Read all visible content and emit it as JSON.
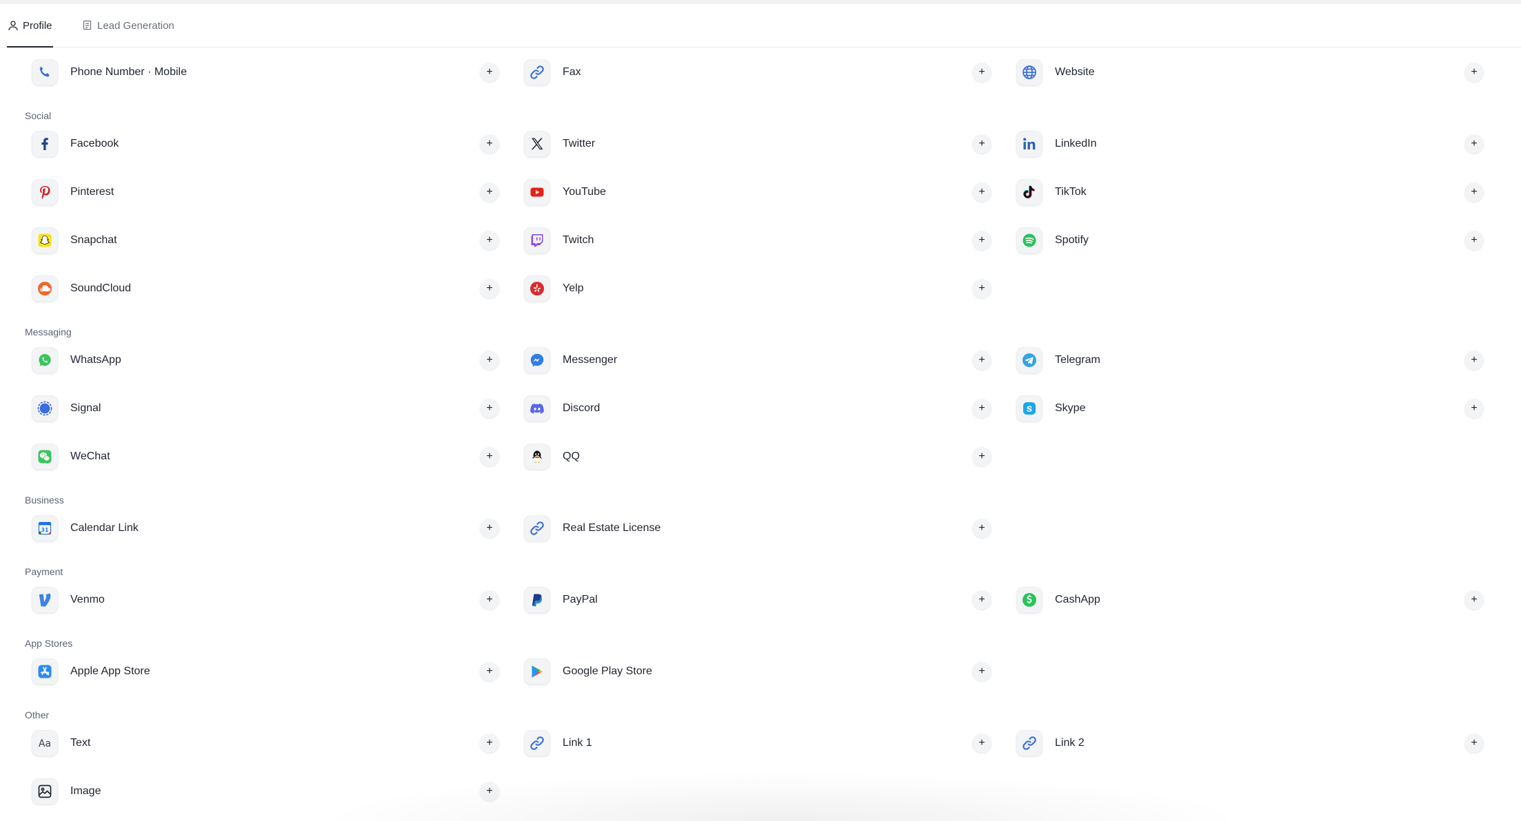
{
  "tabs": [
    {
      "label": "Profile",
      "icon": "user-icon",
      "active": true
    },
    {
      "label": "Lead Generation",
      "icon": "form-icon",
      "active": false
    }
  ],
  "add_label": "+",
  "rows": [
    {
      "type": "items",
      "items": [
        {
          "label": "Phone Number · Mobile",
          "icon": "phone-icon"
        },
        {
          "label": "Fax",
          "icon": "link-icon"
        },
        {
          "label": "Website",
          "icon": "globe-icon"
        }
      ]
    },
    {
      "type": "section",
      "label": "Social"
    },
    {
      "type": "items",
      "items": [
        {
          "label": "Facebook",
          "icon": "facebook-icon"
        },
        {
          "label": "Twitter",
          "icon": "x-twitter-icon"
        },
        {
          "label": "LinkedIn",
          "icon": "linkedin-icon"
        }
      ]
    },
    {
      "type": "items",
      "items": [
        {
          "label": "Pinterest",
          "icon": "pinterest-icon"
        },
        {
          "label": "YouTube",
          "icon": "youtube-icon"
        },
        {
          "label": "TikTok",
          "icon": "tiktok-icon"
        }
      ]
    },
    {
      "type": "items",
      "items": [
        {
          "label": "Snapchat",
          "icon": "snapchat-icon"
        },
        {
          "label": "Twitch",
          "icon": "twitch-icon"
        },
        {
          "label": "Spotify",
          "icon": "spotify-icon"
        }
      ]
    },
    {
      "type": "items",
      "items": [
        {
          "label": "SoundCloud",
          "icon": "soundcloud-icon"
        },
        {
          "label": "Yelp",
          "icon": "yelp-icon"
        }
      ]
    },
    {
      "type": "section",
      "label": "Messaging"
    },
    {
      "type": "items",
      "items": [
        {
          "label": "WhatsApp",
          "icon": "whatsapp-icon"
        },
        {
          "label": "Messenger",
          "icon": "messenger-icon"
        },
        {
          "label": "Telegram",
          "icon": "telegram-icon"
        }
      ]
    },
    {
      "type": "items",
      "items": [
        {
          "label": "Signal",
          "icon": "signal-icon"
        },
        {
          "label": "Discord",
          "icon": "discord-icon"
        },
        {
          "label": "Skype",
          "icon": "skype-icon"
        }
      ]
    },
    {
      "type": "items",
      "items": [
        {
          "label": "WeChat",
          "icon": "wechat-icon"
        },
        {
          "label": "QQ",
          "icon": "qq-icon"
        }
      ]
    },
    {
      "type": "section",
      "label": "Business"
    },
    {
      "type": "items",
      "items": [
        {
          "label": "Calendar Link",
          "icon": "calendar-icon"
        },
        {
          "label": "Real Estate License",
          "icon": "link-icon"
        }
      ]
    },
    {
      "type": "section",
      "label": "Payment"
    },
    {
      "type": "items",
      "items": [
        {
          "label": "Venmo",
          "icon": "venmo-icon"
        },
        {
          "label": "PayPal",
          "icon": "paypal-icon"
        },
        {
          "label": "CashApp",
          "icon": "cashapp-icon"
        }
      ]
    },
    {
      "type": "section",
      "label": "App Stores"
    },
    {
      "type": "items",
      "items": [
        {
          "label": "Apple App Store",
          "icon": "app-store-icon"
        },
        {
          "label": "Google Play Store",
          "icon": "google-play-icon"
        }
      ]
    },
    {
      "type": "section",
      "label": "Other"
    },
    {
      "type": "items",
      "items": [
        {
          "label": "Text",
          "icon": "text-icon"
        },
        {
          "label": "Link 1",
          "icon": "link-icon"
        },
        {
          "label": "Link 2",
          "icon": "link-icon"
        }
      ]
    },
    {
      "type": "items",
      "items": [
        {
          "label": "Image",
          "icon": "image-icon"
        }
      ]
    }
  ],
  "colors": {
    "link": "#3b6fd8",
    "facebook": "#1f3f8f",
    "linkedin": "#2a66b8",
    "pinterest": "#cf2127",
    "youtube": "#e62117",
    "snapchat": "#f7e21b",
    "twitch": "#8a4ce6",
    "spotify": "#2bc25e",
    "soundcloud": "#f0672a",
    "yelp": "#d82d2d",
    "whatsapp": "#3cc55c",
    "messenger": "#2f7ee6",
    "telegram": "#36a3df",
    "signal": "#3a6be0",
    "discord": "#5b67e8",
    "skype": "#1da7e6",
    "wechat": "#3cc55c",
    "venmo": "#3c82e6",
    "paypal": "#1d3b8c",
    "cashapp": "#2cc35c",
    "appstore": "#2b8cf0"
  }
}
